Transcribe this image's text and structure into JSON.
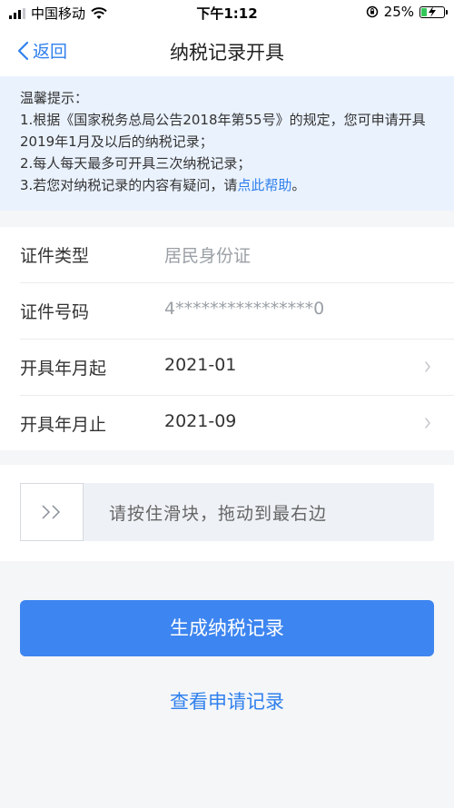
{
  "status_bar": {
    "carrier": "中国移动",
    "time": "下午1:12",
    "battery_percent": "25%",
    "battery_level": 0.25
  },
  "nav": {
    "back_label": "返回",
    "title": "纳税记录开具"
  },
  "tips": {
    "heading": "温馨提示：",
    "line1": "1.根据《国家税务总局公告2018年第55号》的规定，您可申请开具2019年1月及以后的纳税记录；",
    "line2": "2.每人每天最多可开具三次纳税记录；",
    "line3_prefix": "3.若您对纳税记录的内容有疑问，请",
    "line3_link": "点此帮助",
    "line3_suffix": "。"
  },
  "form": {
    "rows": [
      {
        "label": "证件类型",
        "value": "居民身份证"
      },
      {
        "label": "证件号码",
        "value": "4****************0"
      },
      {
        "label": "开具年月起",
        "value": "2021-01"
      },
      {
        "label": "开具年月止",
        "value": "2021-09"
      }
    ]
  },
  "slider": {
    "hint": "请按住滑块，拖动到最右边",
    "progress": 0
  },
  "actions": {
    "generate_label": "生成纳税记录",
    "view_records_label": "查看申请记录"
  },
  "colors": {
    "accent": "#3d85f0",
    "link": "#2f80ed",
    "tips_bg": "#eaf2fe",
    "page_bg": "#f5f6f8",
    "battery": "#34c759"
  }
}
